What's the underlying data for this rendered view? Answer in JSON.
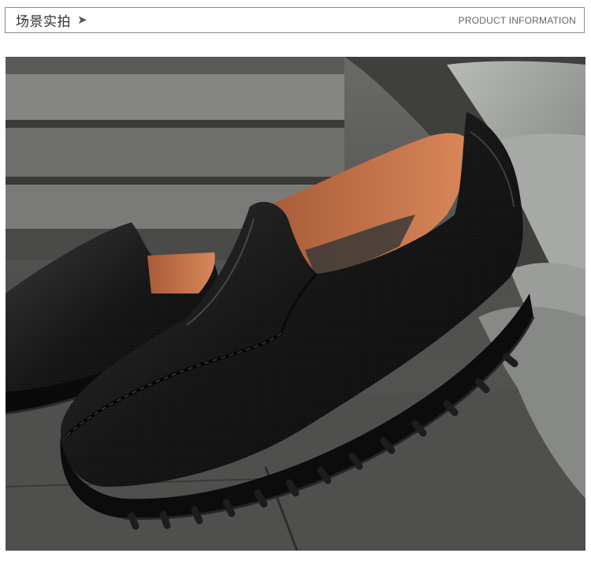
{
  "header": {
    "title": "场景实拍",
    "arrow_icon": "play-arrow-icon",
    "subtitle": "PRODUCT INFORMATION"
  },
  "photo": {
    "subject": "black leather slip-on loafers on stone steps",
    "colors": {
      "leather": "#141414",
      "lining": "#c9744a",
      "stone": "#6b6c6a",
      "tile": "#8d918d"
    }
  }
}
